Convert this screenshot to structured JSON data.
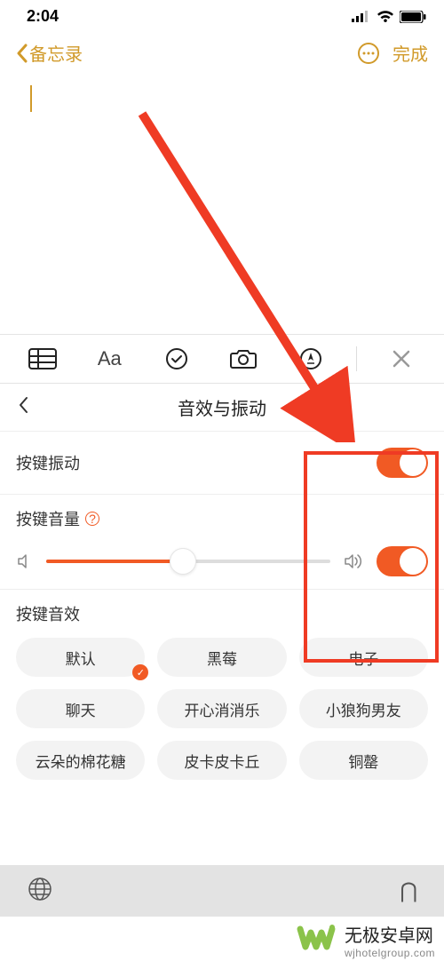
{
  "status": {
    "time": "2:04"
  },
  "nav": {
    "back": "备忘录",
    "done": "完成"
  },
  "settings": {
    "title": "音效与振动",
    "vibration_label": "按键振动",
    "volume_label": "按键音量",
    "effect_label": "按键音效"
  },
  "effects": {
    "items": [
      {
        "label": "默认",
        "selected": true
      },
      {
        "label": "黑莓",
        "selected": false
      },
      {
        "label": "电子",
        "selected": false
      },
      {
        "label": "聊天",
        "selected": false
      },
      {
        "label": "开心消消乐",
        "selected": false
      },
      {
        "label": "小狼狗男友",
        "selected": false
      },
      {
        "label": "云朵的棉花糖",
        "selected": false
      },
      {
        "label": "皮卡皮卡丘",
        "selected": false
      },
      {
        "label": "铜罄",
        "selected": false
      }
    ]
  },
  "watermark": {
    "title": "无极安卓网",
    "url": "wjhotelgroup.com"
  }
}
